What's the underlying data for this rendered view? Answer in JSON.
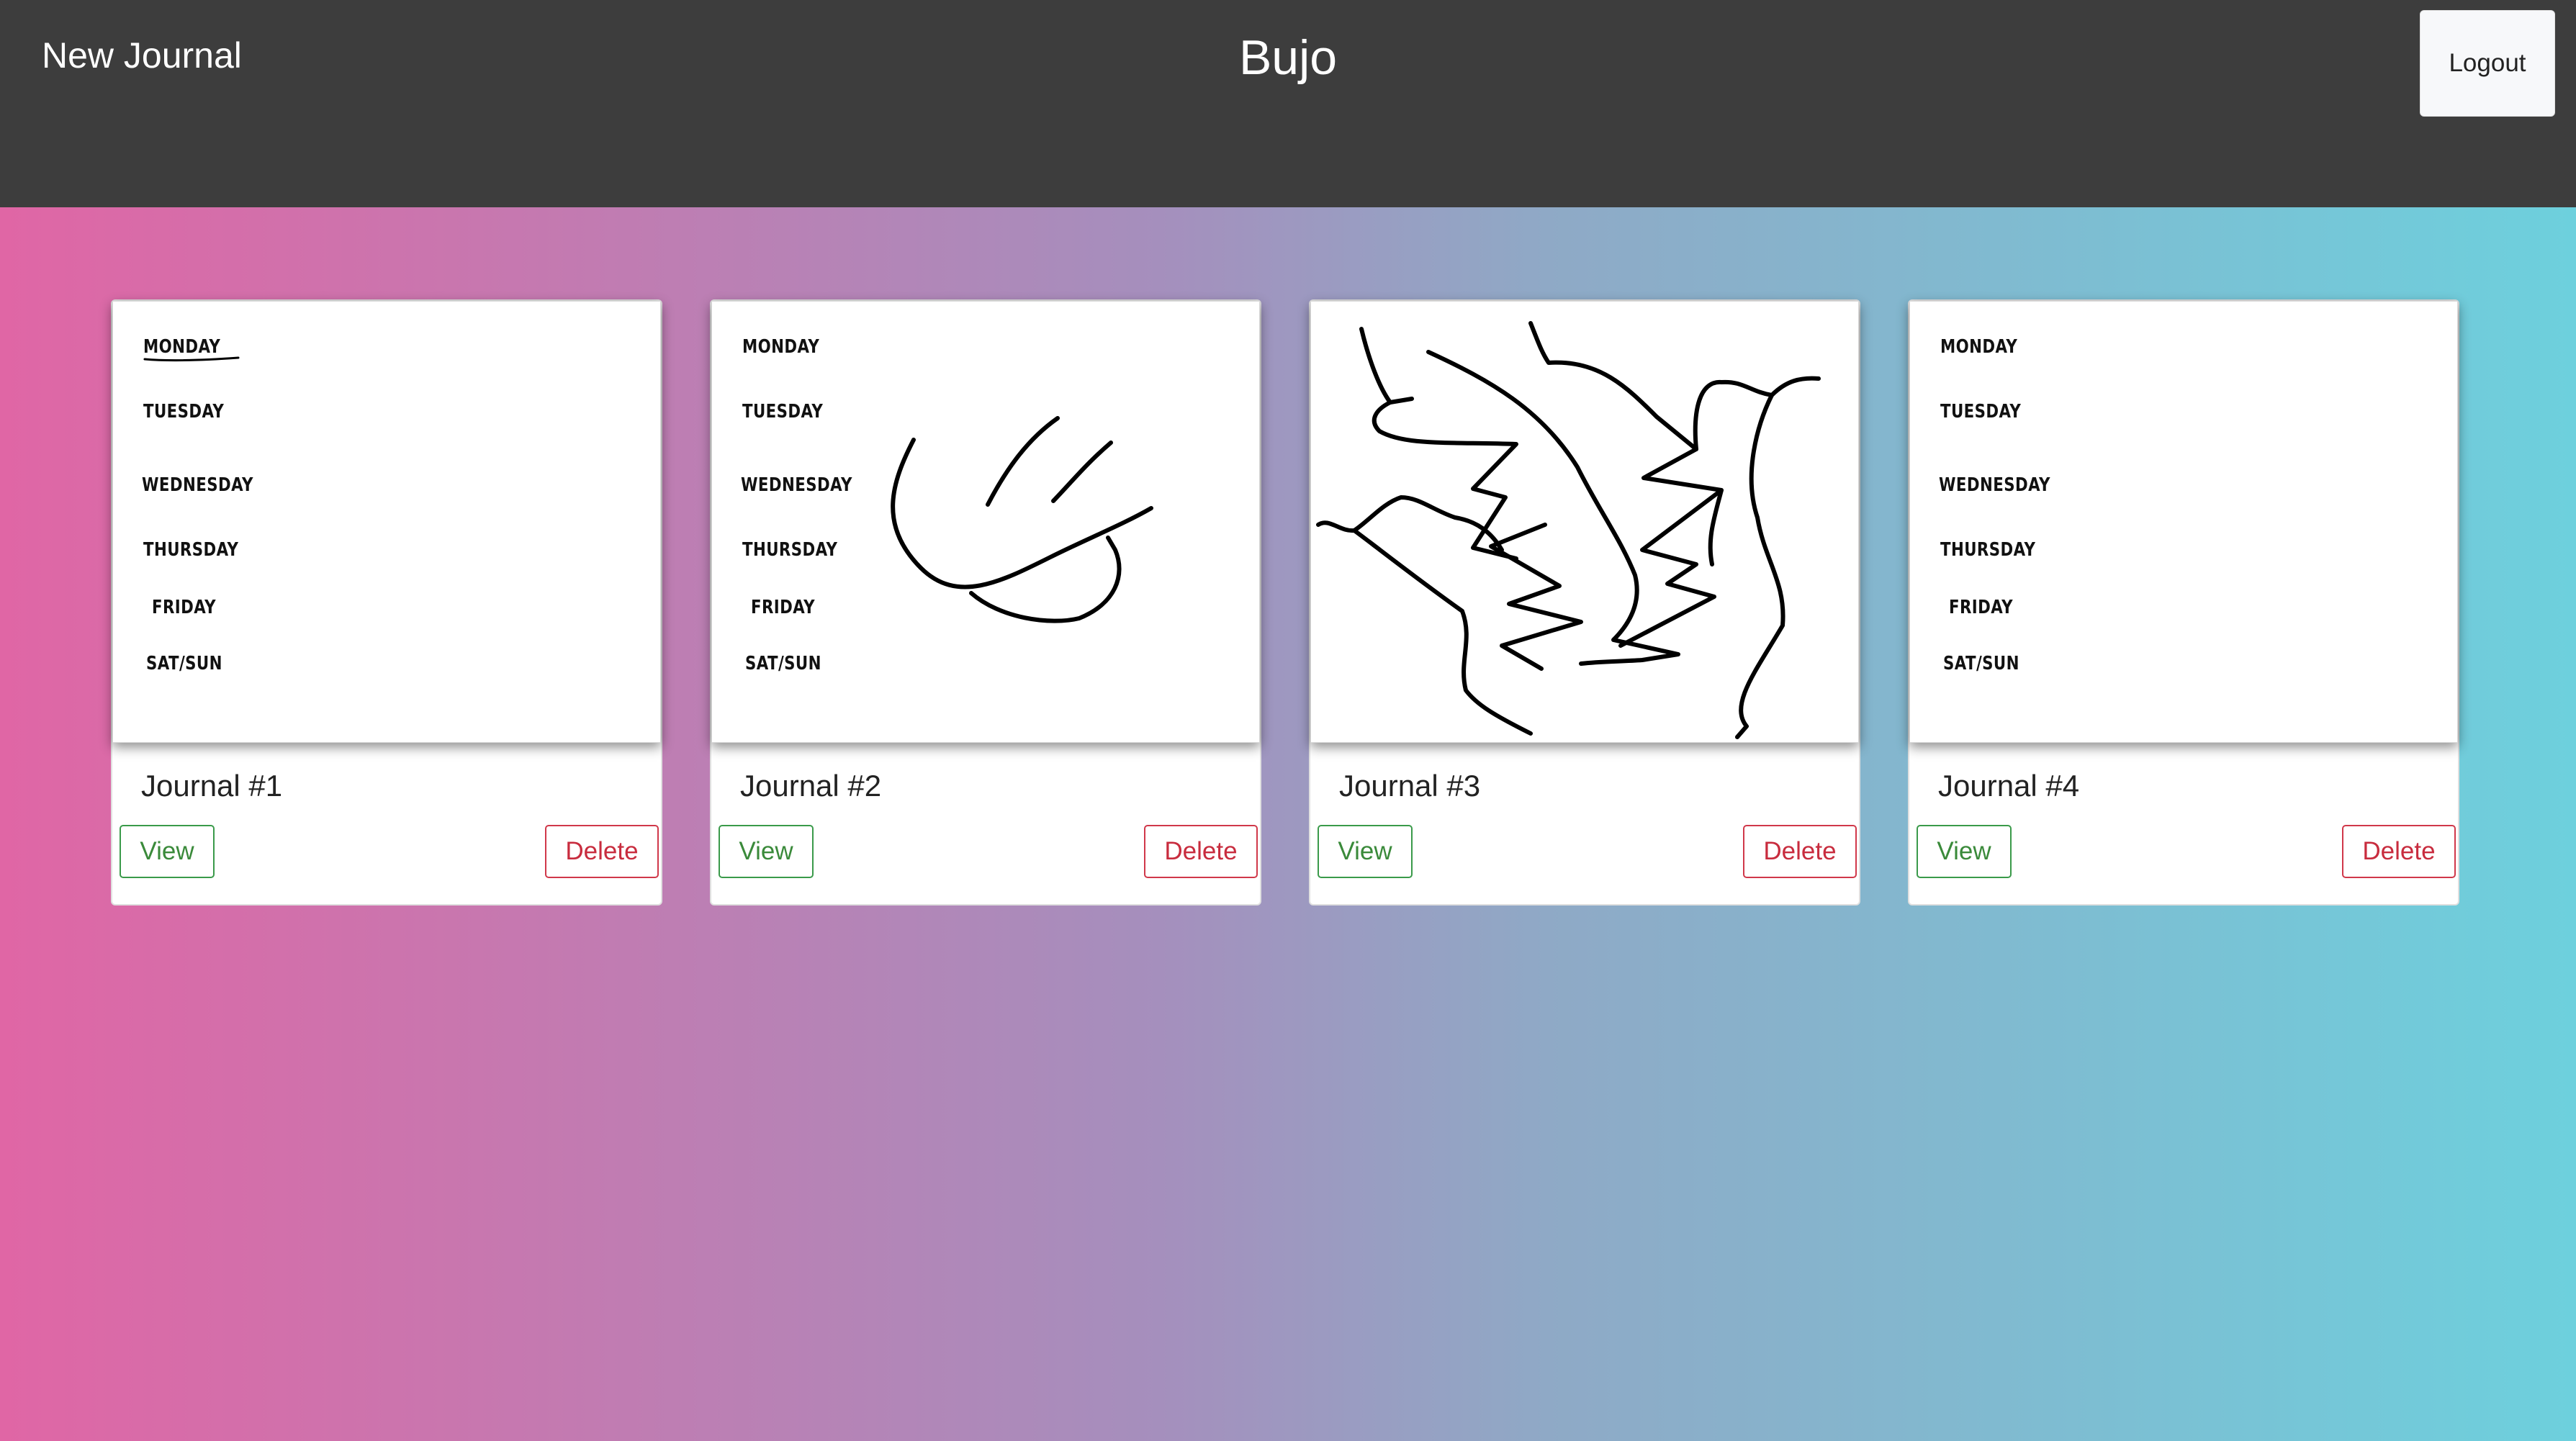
{
  "header": {
    "new_journal_label": "New Journal",
    "brand": "Bujo",
    "logout_label": "Logout"
  },
  "colors": {
    "header_bg": "#3d3d3d",
    "gradient_start": "#e066a5",
    "gradient_end": "#6dd0dd",
    "view_button": "#3a9a4a",
    "delete_button": "#d0384a"
  },
  "days": [
    "MONDAY",
    "TUESDAY",
    "WEDNESDAY",
    "THURSDAY",
    "FRIDAY",
    "SAT/SUN"
  ],
  "journals": [
    {
      "title": "Journal #1",
      "view_label": "View",
      "delete_label": "Delete",
      "thumbnail": "weekday-list"
    },
    {
      "title": "Journal #2",
      "view_label": "View",
      "delete_label": "Delete",
      "thumbnail": "weekday-list-with-doodle"
    },
    {
      "title": "Journal #3",
      "view_label": "View",
      "delete_label": "Delete",
      "thumbnail": "scribble-drawing"
    },
    {
      "title": "Journal #4",
      "view_label": "View",
      "delete_label": "Delete",
      "thumbnail": "weekday-list"
    }
  ]
}
